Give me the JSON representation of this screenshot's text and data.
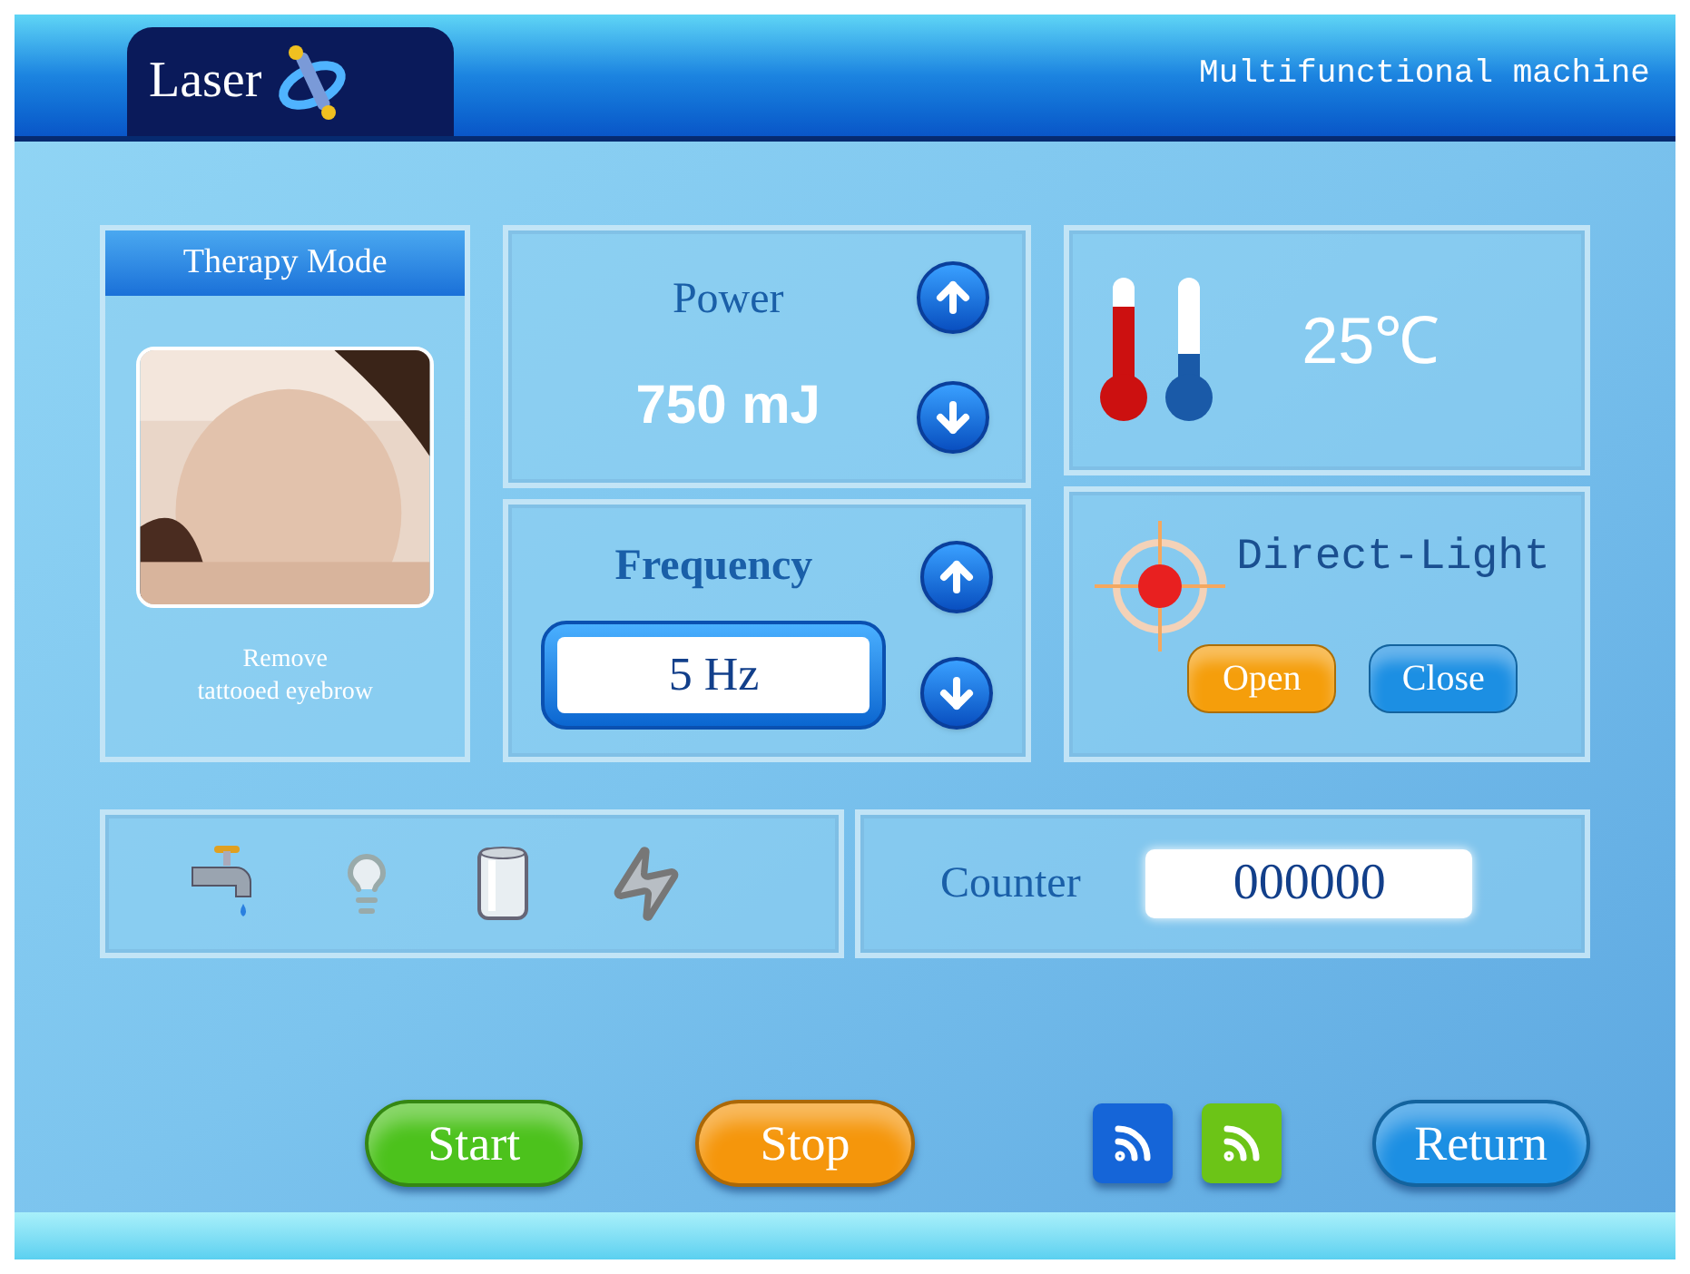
{
  "header": {
    "logo": "Laser",
    "title": "Multifunctional machine"
  },
  "therapy_mode": {
    "title": "Therapy Mode",
    "caption_lines": [
      "Remove",
      "tattooed eyebrow"
    ]
  },
  "power": {
    "label": "Power",
    "value": "750 mJ"
  },
  "frequency": {
    "label": "Frequency",
    "value": "5 Hz"
  },
  "temperature": {
    "value": "25℃"
  },
  "direct_light": {
    "label": "Direct-Light",
    "buttons": [
      {
        "label": "Open",
        "color": "#f59e0b"
      },
      {
        "label": "Close",
        "color": "#1c8fe3"
      }
    ]
  },
  "status_icons": [
    {
      "kind": "tap"
    },
    {
      "kind": "bulb"
    },
    {
      "kind": "cylinder"
    },
    {
      "kind": "bolt"
    }
  ],
  "counter": {
    "label": "Counter",
    "value": "000000"
  },
  "actions": [
    {
      "label": "Start",
      "color": "#4cc21c"
    },
    {
      "label": "Stop",
      "color": "#f5960b"
    }
  ],
  "feed_icons": [
    {
      "color": "#1565d8"
    },
    {
      "color": "#6cc417"
    }
  ],
  "return_button": {
    "label": "Return",
    "color": "#1c8fe3"
  }
}
